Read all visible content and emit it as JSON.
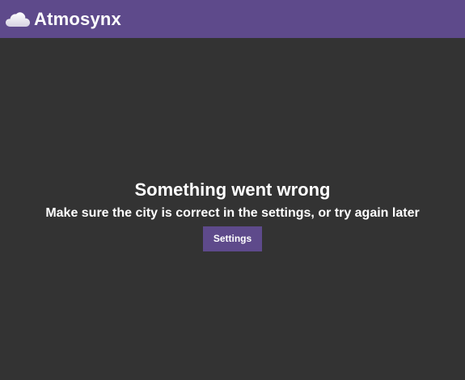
{
  "header": {
    "app_title": "Atmosynx",
    "logo_icon": "cloud-icon"
  },
  "error": {
    "title": "Something went wrong",
    "message": "Make sure the city is correct in the settings, or try again later",
    "settings_button": "Settings"
  },
  "colors": {
    "accent": "#5e4a8b",
    "background": "#333333",
    "text": "#ffffff"
  }
}
